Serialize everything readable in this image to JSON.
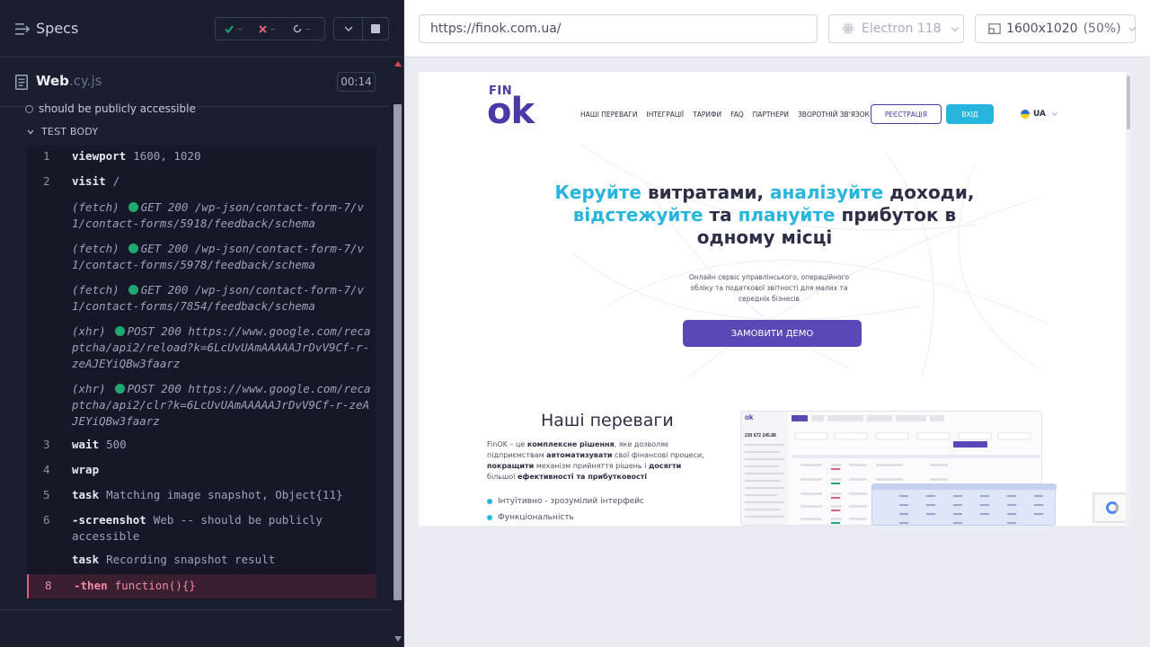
{
  "reporter": {
    "title": "Specs",
    "stats": {
      "passed": "–",
      "failed": "–",
      "pending": "–"
    },
    "file": {
      "name": "Web",
      "ext": ".cy.js"
    },
    "timer": "00:14",
    "test_title": "should be publicly accessible",
    "test_body_label": "TEST BODY",
    "commands": [
      {
        "num": "1",
        "name": "viewport",
        "arg": "1600, 1020"
      },
      {
        "num": "2",
        "name": "visit",
        "arg": "/"
      },
      {
        "num": "3",
        "name": "wait",
        "arg": "500"
      },
      {
        "num": "4",
        "name": "wrap",
        "arg": ""
      },
      {
        "num": "5",
        "name": "task",
        "arg": "Matching image snapshot, Object{11}"
      },
      {
        "num": "6",
        "name": "-screenshot",
        "arg": "Web -- should be publicly accessible"
      },
      {
        "num": "",
        "name": "task",
        "arg": "Recording snapshot result"
      },
      {
        "num": "8",
        "name": "-then",
        "arg": "function(){}"
      }
    ],
    "events": [
      {
        "type": "(fetch)",
        "text": "GET 200 /wp-json/contact-form-7/v1/contact-forms/5918/feedback/schema"
      },
      {
        "type": "(fetch)",
        "text": "GET 200 /wp-json/contact-form-7/v1/contact-forms/5978/feedback/schema"
      },
      {
        "type": "(fetch)",
        "text": "GET 200 /wp-json/contact-form-7/v1/contact-forms/7854/feedback/schema"
      },
      {
        "type": "(xhr)",
        "text": "POST 200 https://www.google.com/recaptcha/api2/reload?k=6LcUvUAmAAAAAJrDvV9Cf-r-zeAJEYiQBw3faarz"
      },
      {
        "type": "(xhr)",
        "text": "POST 200 https://www.google.com/recaptcha/api2/clr?k=6LcUvUAmAAAAAJrDvV9Cf-r-zeAJEYiQBw3faarz"
      }
    ]
  },
  "browser_bar": {
    "url": "https://finok.com.ua/",
    "browser": "Electron 118",
    "viewport": "1600x1020",
    "scale": "(50%)"
  },
  "site": {
    "logo_top": "FIN",
    "logo_main": "ok",
    "nav": [
      "НАШІ ПЕРЕВАГИ",
      "ІНТЕГРАЦІЇ",
      "ТАРИФИ",
      "FAQ",
      "ПАРТНЕРИ",
      "ЗВОРОТНІЙ ЗВ'ЯЗОК"
    ],
    "register": "РЕЄСТРАЦІЯ",
    "login": "ВХІД",
    "lang": "UA",
    "hero": {
      "hl1": "Керуйте",
      "t1": " витратами, ",
      "hl2": "аналізуйте",
      "t2": " доходи, ",
      "hl3": "відстежуйте",
      "t3": " та ",
      "hl4": "плануйте",
      "t4": " прибуток в одному місці"
    },
    "subtitle": "Онлайн сервіс управлінського, операційного обліку та податкової звітності для малих та середніх бізнесів",
    "demo_button": "ЗАМОВИТИ ДЕМО",
    "advantages": {
      "title": "Наші переваги",
      "p1": "FinOK – це ",
      "b1": "комплексне рішення",
      "p2": ", яке дозволяє підприємствам ",
      "b2": "автоматизувати",
      "p3": " свої фінансові процеси, ",
      "b3": "покращити",
      "p4": " механізм прийняття рішень і ",
      "b4": "досягти",
      "p5": " більшої ",
      "b5": "ефективності та прибутковості",
      "features": [
        "Інтуїтивно - зрозумілий інтерфейс",
        "Функціональність"
      ]
    },
    "mock_balance": "230 672 245.88"
  }
}
